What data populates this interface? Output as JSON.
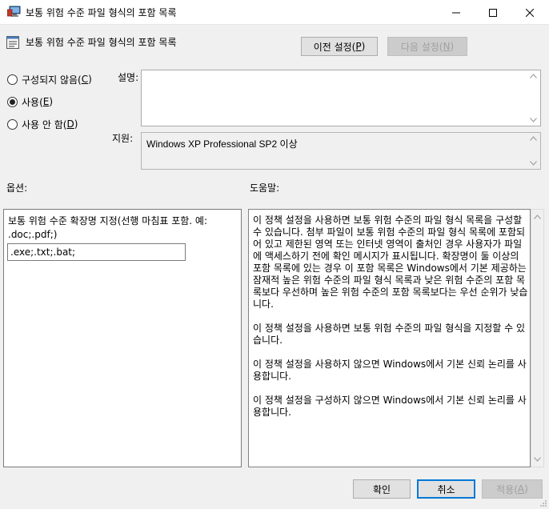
{
  "window": {
    "title": "보통 위험 수준 파일 형식의 포함 목록"
  },
  "header": {
    "title": "보통 위험 수준 파일 형식의 포함 목록",
    "prev_button": {
      "text": "이전 설정(",
      "key": "P",
      "end": ")"
    },
    "next_button": {
      "text": "다음 설정(",
      "key": "N",
      "end": ")"
    }
  },
  "state": {
    "options": [
      {
        "text": "구성되지 않음(",
        "key": "C",
        "end": ")",
        "checked": false
      },
      {
        "text": "사용(",
        "key": "E",
        "end": ")",
        "checked": true
      },
      {
        "text": "사용 안 함(",
        "key": "D",
        "end": ")",
        "checked": false
      }
    ]
  },
  "comment": {
    "label": "설명:",
    "value": ""
  },
  "supported": {
    "label": "지원:",
    "value": "Windows XP Professional SP2 이상"
  },
  "options_section": {
    "label": "옵션:",
    "description": "보통 위험 수준 확장명 지정(선행 마침표 포함. 예: .doc;.pdf;)",
    "input_value": ".exe;.txt;.bat;"
  },
  "help_section": {
    "label": "도움말:",
    "paragraphs": [
      "이 정책 설정을 사용하면 보통 위험 수준의 파일 형식 목록을 구성할 수 있습니다. 첨부 파일이 보통 위험 수준의 파일 형식 목록에 포함되어 있고 제한된 영역 또는 인터넷 영역이 출처인 경우 사용자가 파일에 액세스하기 전에 확인 메시지가 표시됩니다. 확장명이 둘 이상의 포함 목록에 있는 경우 이 포함 목록은 Windows에서 기본 제공하는 잠재적 높은 위험 수준의 파일 형식 목록과 낮은 위험 수준의 포함 목록보다 우선하며 높은 위험 수준의 포함 목록보다는 우선 순위가 낮습니다.",
      "이 정책 설정을 사용하면 보통 위험 수준의 파일 형식을 지정할 수 있습니다.",
      "이 정책 설정을 사용하지 않으면 Windows에서 기본 신뢰 논리를 사용합니다.",
      "이 정책 설정을 구성하지 않으면 Windows에서 기본 신뢰 논리를 사용합니다."
    ]
  },
  "footer": {
    "ok_label": "확인",
    "cancel_label": "취소",
    "apply_button": {
      "text": "적용(",
      "key": "A",
      "end": ")"
    }
  },
  "colors": {
    "background": "#f0f0f0",
    "accent": "#0078d7",
    "disabled_text": "#a0a0a0"
  },
  "icons": {
    "title": "group-policy-icon",
    "header": "policy-setting-icon"
  }
}
